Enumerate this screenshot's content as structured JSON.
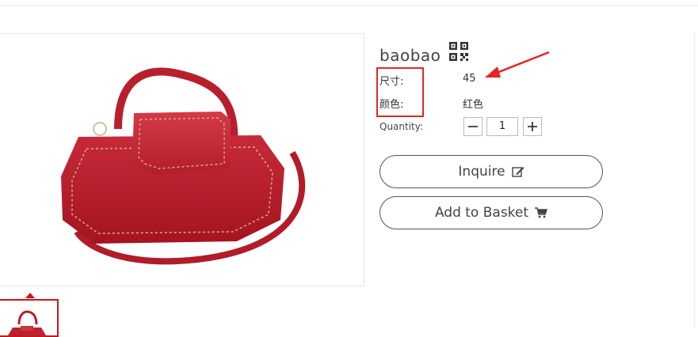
{
  "product": {
    "title": "baobao",
    "qr_icon": "qr-code-icon",
    "attributes": [
      {
        "label": "尺寸:",
        "value": "45"
      },
      {
        "label": "颜色:",
        "value": "红色"
      }
    ],
    "quantity": {
      "label": "Quantity:",
      "value": "1",
      "minus_icon": "minus-icon",
      "plus_icon": "plus-icon"
    },
    "buttons": {
      "inquire": {
        "label": "Inquire",
        "icon": "edit-icon"
      },
      "add_to_basket": {
        "label": "Add to Basket",
        "icon": "cart-icon"
      }
    }
  },
  "colors": {
    "accent_red": "#c8161d",
    "annotation_red": "#e32626"
  }
}
